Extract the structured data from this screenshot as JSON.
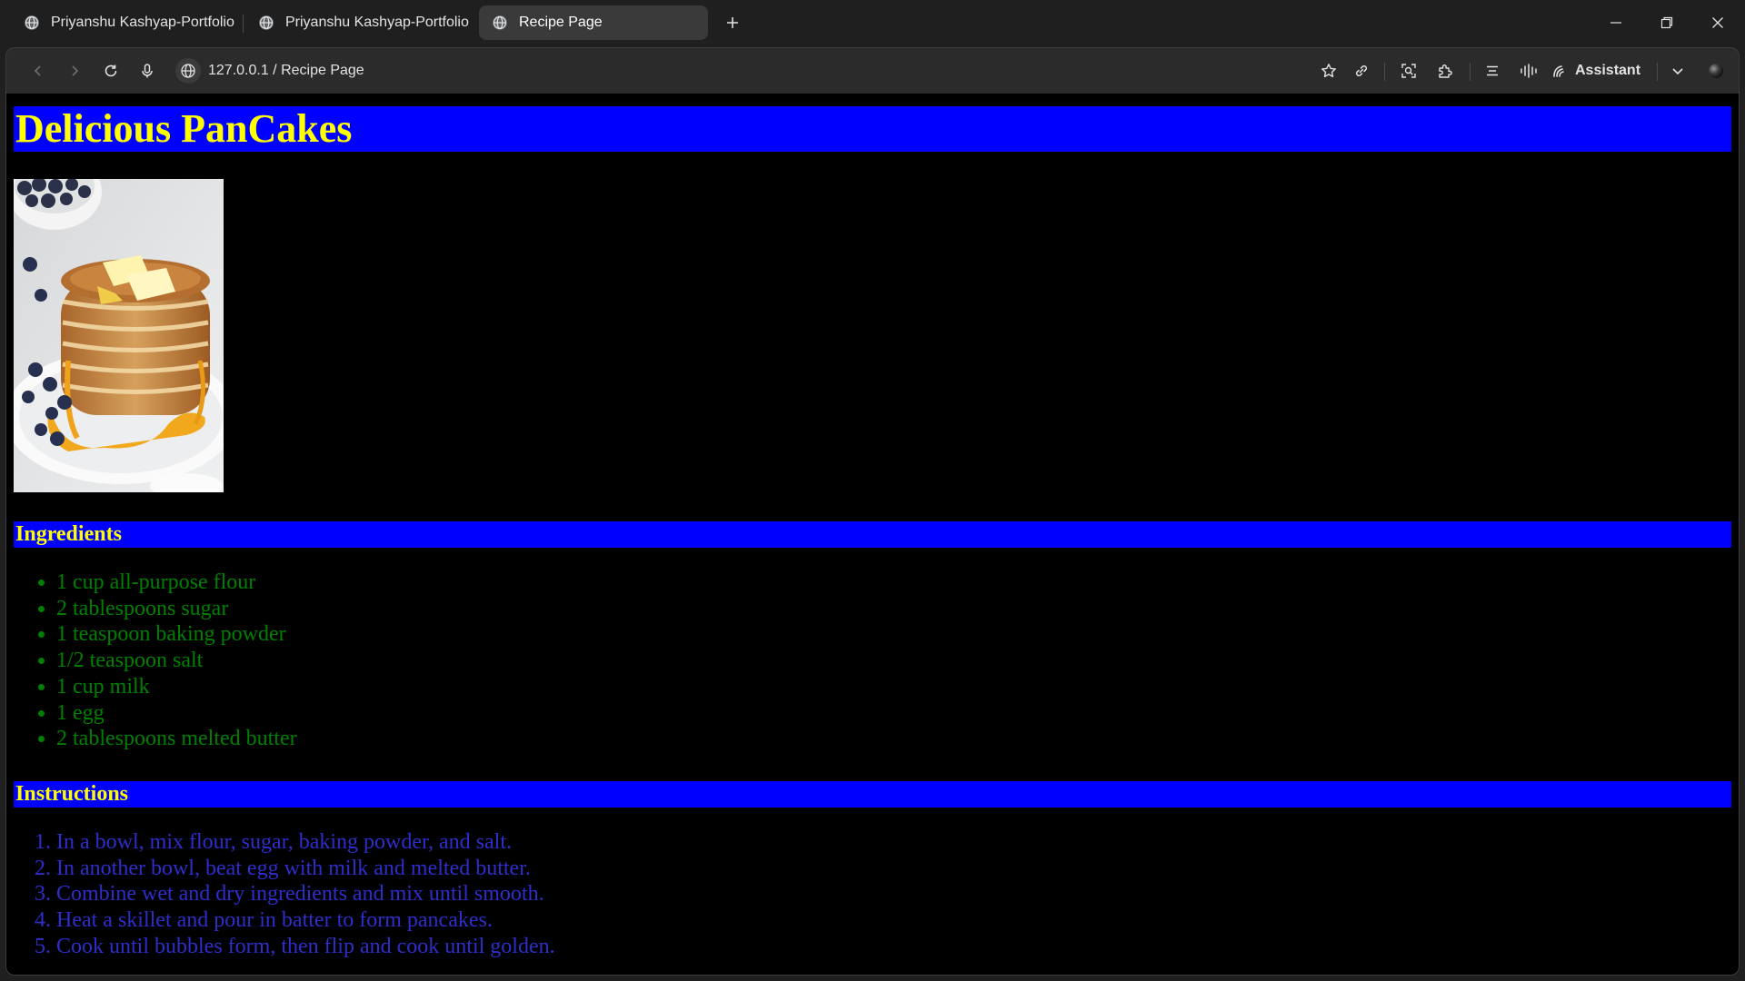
{
  "tabs": [
    {
      "label": "Priyanshu Kashyap-Portfolio",
      "active": false
    },
    {
      "label": "Priyanshu Kashyap-Portfolio",
      "active": false
    },
    {
      "label": "Recipe Page",
      "active": true
    }
  ],
  "address_bar": {
    "url": "127.0.0.1 / Recipe Page"
  },
  "toolbar": {
    "assistant_label": "Assistant"
  },
  "page": {
    "title": "Delicious PanCakes",
    "image_alt": "Stack of pancakes with butter, syrup and blueberries",
    "ingredients_heading": "Ingredients",
    "ingredients": [
      "1 cup all-purpose flour",
      "2 tablespoons sugar",
      "1 teaspoon baking powder",
      "1/2 teaspoon salt",
      "1 cup milk",
      "1 egg",
      "2 tablespoons melted butter"
    ],
    "instructions_heading": "Instructions",
    "instructions": [
      "In a bowl, mix flour, sugar, baking powder, and salt.",
      "In another bowl, beat egg with milk and melted butter.",
      "Combine wet and dry ingredients and mix until smooth.",
      "Heat a skillet and pour in batter to form pancakes.",
      "Cook until bubbles form, then flip and cook until golden."
    ]
  },
  "colors": {
    "heading_bg": "#0000ff",
    "heading_text": "#ffff00",
    "ingredients_text": "#008000",
    "instructions_text": "#2e2ecc",
    "page_bg": "#000000"
  }
}
